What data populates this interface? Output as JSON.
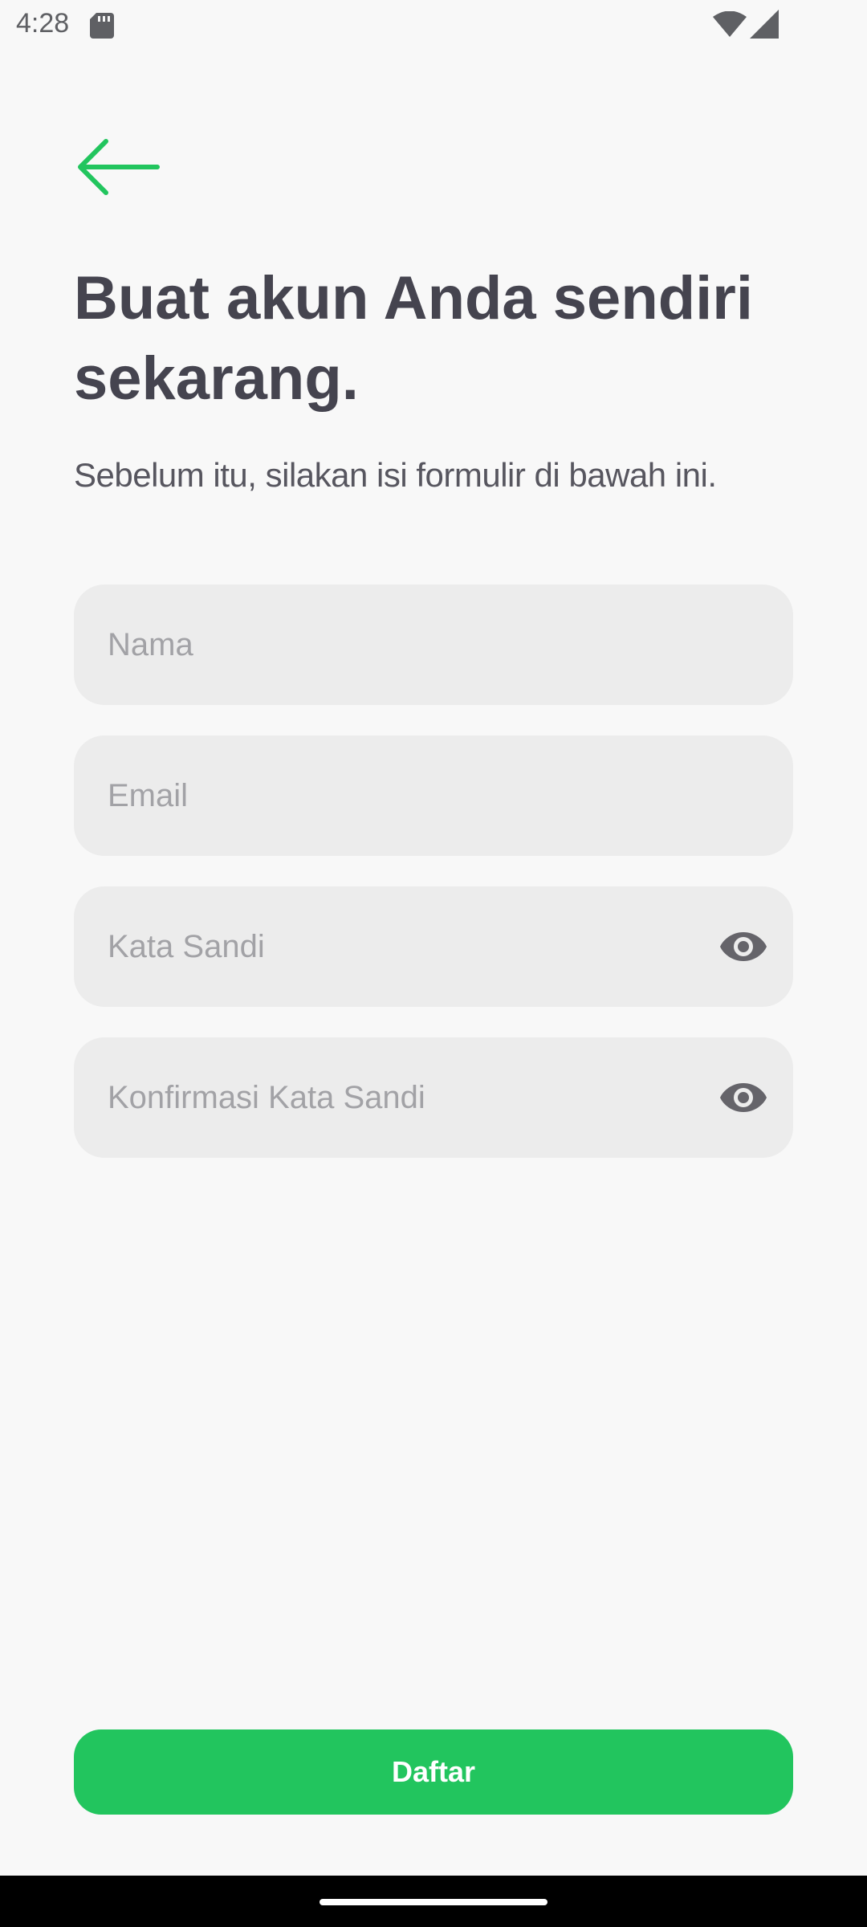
{
  "status_bar": {
    "time": "4:28"
  },
  "header": {
    "back_icon": "arrow-left-icon"
  },
  "content": {
    "title": "Buat akun Anda sendiri sekarang.",
    "subtitle": "Sebelum itu, silakan isi formulir di bawah ini."
  },
  "form": {
    "name_placeholder": "Nama",
    "email_placeholder": "Email",
    "password_placeholder": "Kata Sandi",
    "confirm_password_placeholder": "Konfirmasi Kata Sandi",
    "visibility_icon": "eye-icon"
  },
  "actions": {
    "register_label": "Daftar"
  },
  "colors": {
    "accent": "#22c55e",
    "background": "#f8f8f8",
    "field_background": "#ececec",
    "title_text": "#45444f",
    "placeholder_text": "#a2a2a6"
  }
}
